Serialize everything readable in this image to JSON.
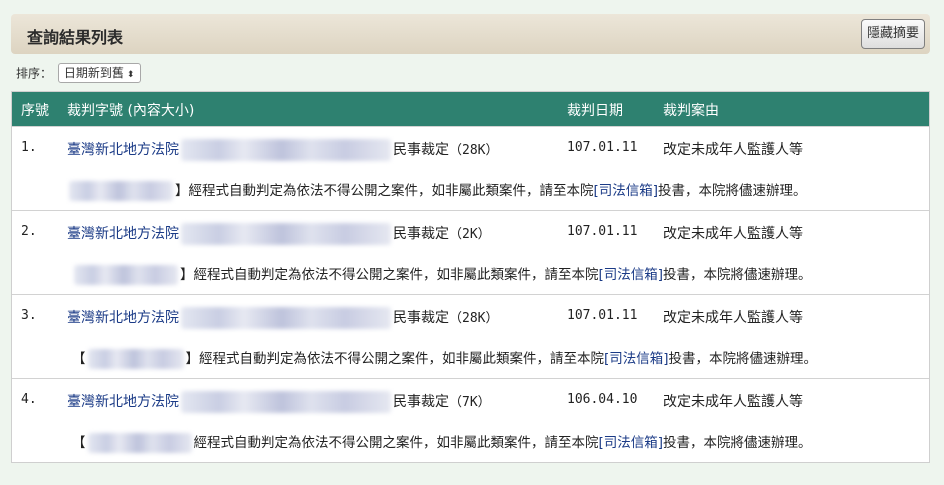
{
  "header": {
    "title": "查詢結果列表",
    "hide_summary_label": "隱藏摘要"
  },
  "sort": {
    "label": "排序：",
    "selected": "日期新到舊"
  },
  "table": {
    "columns": {
      "index": "序號",
      "case_no": "裁判字號 (內容大小)",
      "date": "裁判日期",
      "reason": "裁判案由"
    },
    "rows": [
      {
        "index": "1.",
        "court": "臺灣新北地方法院",
        "case_type": "民事裁定",
        "size": "（28K）",
        "date": "107.01.11",
        "reason": "改定未成年人監護人等",
        "note_prefix": "",
        "note_bracket": "】",
        "note_text": "經程式自動判定為依法不得公開之案件，如非屬此類案件，請至本院",
        "note_link": "[司法信箱]",
        "note_suffix": "投書，本院將儘速辦理。"
      },
      {
        "index": "2.",
        "court": "臺灣新北地方法院",
        "case_type": "民事裁定",
        "size": "（2K）",
        "date": "107.01.11",
        "reason": "改定未成年人監護人等",
        "note_prefix": "",
        "note_bracket": "】",
        "note_text": "經程式自動判定為依法不得公開之案件，如非屬此類案件，請至本院",
        "note_link": "[司法信箱]",
        "note_suffix": "投書，本院將儘速辦理。"
      },
      {
        "index": "3.",
        "court": "臺灣新北地方法院",
        "case_type": "民事裁定",
        "size": "（28K）",
        "date": "107.01.11",
        "reason": "改定未成年人監護人等",
        "note_prefix": "【",
        "note_bracket": "】",
        "note_text": "經程式自動判定為依法不得公開之案件，如非屬此類案件，請至本院",
        "note_link": "[司法信箱]",
        "note_suffix": "投書，本院將儘速辦理。"
      },
      {
        "index": "4.",
        "court": "臺灣新北地方法院",
        "case_type": "民事裁定",
        "size": "（7K）",
        "date": "106.04.10",
        "reason": "改定未成年人監護人等",
        "note_prefix": "【",
        "note_bracket": "",
        "note_text": "經程式自動判定為依法不得公開之案件，如非屬此類案件，請至本院",
        "note_link": "[司法信箱]",
        "note_suffix": "投書，本院將儘速辦理。"
      }
    ]
  }
}
